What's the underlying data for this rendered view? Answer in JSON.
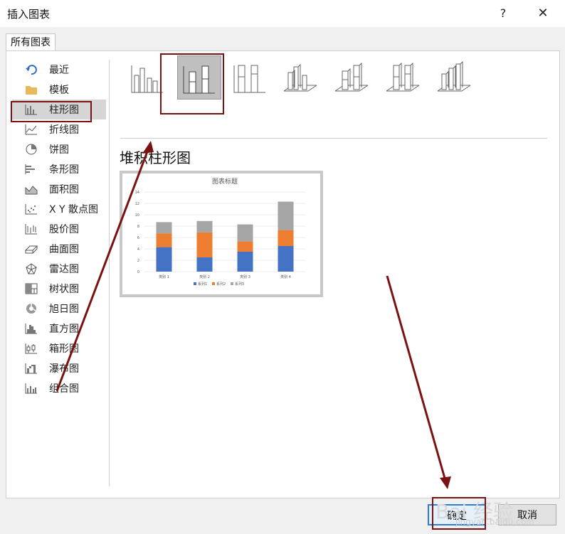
{
  "dialog": {
    "title": "插入图表",
    "help_label": "?",
    "close_label": "✕"
  },
  "tab": {
    "label": "所有图表"
  },
  "sidebar": {
    "items": [
      {
        "label": "最近",
        "icon": "undo-icon"
      },
      {
        "label": "模板",
        "icon": "folder-icon"
      },
      {
        "label": "柱形图",
        "icon": "column-chart-icon",
        "selected": true
      },
      {
        "label": "折线图",
        "icon": "line-chart-icon"
      },
      {
        "label": "饼图",
        "icon": "pie-chart-icon"
      },
      {
        "label": "条形图",
        "icon": "bar-chart-icon"
      },
      {
        "label": "面积图",
        "icon": "area-chart-icon"
      },
      {
        "label": "X Y 散点图",
        "icon": "scatter-chart-icon"
      },
      {
        "label": "股价图",
        "icon": "stock-chart-icon"
      },
      {
        "label": "曲面图",
        "icon": "surface-chart-icon"
      },
      {
        "label": "雷达图",
        "icon": "radar-chart-icon"
      },
      {
        "label": "树状图",
        "icon": "treemap-chart-icon"
      },
      {
        "label": "旭日图",
        "icon": "sunburst-chart-icon"
      },
      {
        "label": "直方图",
        "icon": "histogram-chart-icon"
      },
      {
        "label": "箱形图",
        "icon": "box-chart-icon"
      },
      {
        "label": "瀑布图",
        "icon": "waterfall-chart-icon"
      },
      {
        "label": "组合图",
        "icon": "combo-chart-icon"
      }
    ]
  },
  "subtypes": {
    "selected_index": 1,
    "selected_title": "堆积柱形图",
    "items": [
      "clustered-column-icon",
      "stacked-column-icon",
      "100-stacked-column-icon",
      "3d-clustered-column-icon",
      "3d-stacked-column-icon",
      "3d-100-stacked-column-icon",
      "3d-column-icon"
    ]
  },
  "colors": {
    "series1": "#4472c4",
    "series2": "#ed7d31",
    "series3": "#a5a5a5",
    "annotation": "#7a1212"
  },
  "chart_data": {
    "type": "bar",
    "stacked": true,
    "title": "图表标题",
    "categories": [
      "类别 1",
      "类别 2",
      "类别 3",
      "类别 4"
    ],
    "series": [
      {
        "name": "系列1",
        "values": [
          4.3,
          2.5,
          3.5,
          4.5
        ]
      },
      {
        "name": "系列2",
        "values": [
          2.4,
          4.4,
          1.8,
          2.8
        ]
      },
      {
        "name": "系列3",
        "values": [
          2.0,
          2.0,
          3.0,
          5.0
        ]
      }
    ],
    "yticks": [
      "0",
      "2",
      "4",
      "6",
      "8",
      "10",
      "12",
      "14"
    ],
    "ylim": [
      0,
      14
    ],
    "grid": true,
    "legend_position": "bottom"
  },
  "buttons": {
    "ok": "确定",
    "cancel": "取消"
  },
  "watermark": {
    "main": "Bai 经验",
    "sub": "jingyan.baidu.com"
  }
}
